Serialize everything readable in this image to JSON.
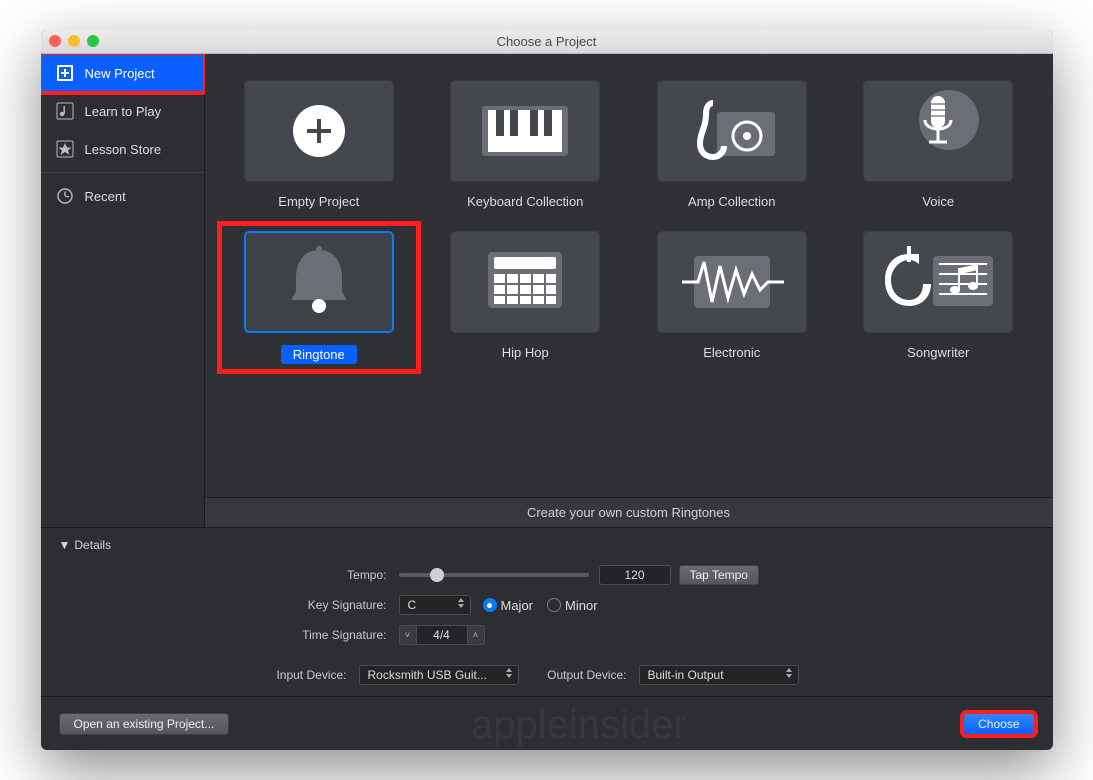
{
  "window": {
    "title": "Choose a Project"
  },
  "sidebar": {
    "items": [
      {
        "label": "New Project",
        "icon": "new-project-icon"
      },
      {
        "label": "Learn to Play",
        "icon": "learn-icon"
      },
      {
        "label": "Lesson Store",
        "icon": "star-icon"
      },
      {
        "label": "Recent",
        "icon": "clock-icon"
      }
    ]
  },
  "projects": [
    {
      "label": "Empty Project"
    },
    {
      "label": "Keyboard Collection"
    },
    {
      "label": "Amp Collection"
    },
    {
      "label": "Voice"
    },
    {
      "label": "Ringtone"
    },
    {
      "label": "Hip Hop"
    },
    {
      "label": "Electronic"
    },
    {
      "label": "Songwriter"
    }
  ],
  "description": "Create your own custom Ringtones",
  "details": {
    "heading": "Details",
    "tempo_label": "Tempo:",
    "tempo_value": "120",
    "tap_tempo": "Tap Tempo",
    "key_label": "Key Signature:",
    "key_value": "C",
    "major": "Major",
    "minor": "Minor",
    "time_label": "Time Signature:",
    "time_value": "4/4",
    "input_label": "Input Device:",
    "input_value": "Rocksmith USB Guit...",
    "output_label": "Output Device:",
    "output_value": "Built-in Output"
  },
  "footer": {
    "open_existing": "Open an existing Project...",
    "choose": "Choose"
  },
  "watermark": "appleinsider",
  "ui": {
    "tempo_slider_pos_pct": 20
  }
}
